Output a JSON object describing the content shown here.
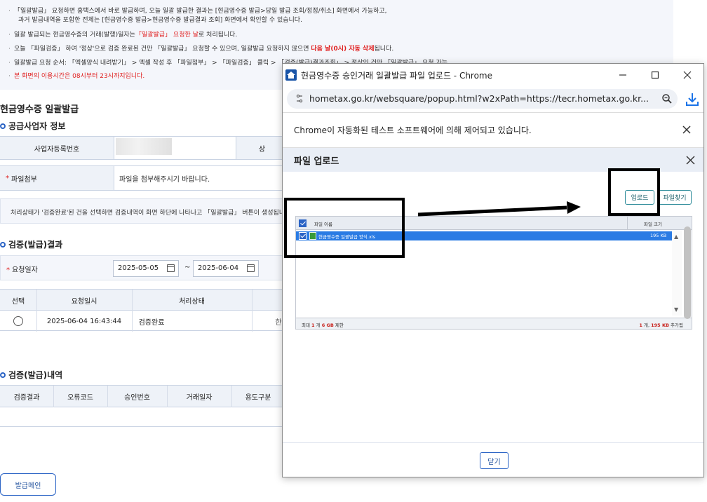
{
  "notice": {
    "line1": "「일괄발급」 요청하면 홈택스에서 바로 발급하며, 오늘 일괄 발급한 결과는 [현금영수증 발급>당일 발급 조회/정정/취소] 화면에서 가능하고,",
    "line2": "과거 발급내역을 포함한 전체는 [현금영수증 발급>현금영수증 발급결과 조회] 화면에서 확인할 수 있습니다.",
    "line3_pre": "일괄 발급되는 현금영수증의 거래(발행)일자는",
    "line3_red": "「일괄발급」 요청한 날",
    "line3_post": "로 처리됩니다.",
    "line4_pre": "오늘 「파일검증」 하여 '정상'으로 검증 완료된 건만 「일괄발급」 요청할 수 있으며, 일괄발급 요청하지 않으면",
    "line4_red": "다음 날(0시) 자동 삭제",
    "line4_post": "됩니다.",
    "line5": "일괄발급 요청 순서: 「엑셀양식 내려받기」 > 엑셀 작성 후 「파일첨부」 > 「파일검증」 클릭 > 「검증(발급)결과조회」 > 정상인 건만 「일괄발급」 요청 가능",
    "line6": "본 화면의 이용시간은 08시부터 23시까지입니다."
  },
  "page": {
    "title": "현금영수증 일괄발급",
    "sec_supplier": "공급사업자 정보",
    "biz_no_label": "사업자등록번호",
    "biz_label_cut": "상",
    "file_attach_label": "파일첨부",
    "file_attach_text": "파일을 첨부해주시기 바랍니다.",
    "status_note": "처리상태가 '검증완료'된 건을 선택하면 검증내역이 화면 하단에 나타나고 「일괄발급」 버튼이 생성됩니다.",
    "sec_result": "검증(발급)결과",
    "request_date_label": "요청일자",
    "date_from": "2025-05-05",
    "date_tilde": "~",
    "date_to": "2025-06-04",
    "result_headers": {
      "select": "선택",
      "request_time": "요청일시",
      "status": "처리상태"
    },
    "result_row": {
      "request_time": "2025-06-04 16:43:44",
      "status": "검증완료",
      "cut": "한"
    },
    "sec_detail": "검증(발급)내역",
    "detail_headers": {
      "verify": "검증결과",
      "error": "오류코드",
      "approval": "승인번호",
      "date": "거래일자",
      "purpose": "용도구분"
    },
    "main_button": "발급메인"
  },
  "popup": {
    "window_title": "현금영수증 승인거래 일괄발급 파일 업로드 - Chrome",
    "url": "hometax.go.kr/websquare/popup.html?w2xPath=https://tecr.hometax.go.kr...",
    "automation_msg": "Chrome이 자동화된 테스트 소프트웨어에 의해 제어되고 있습니다.",
    "dialog_title": "파일 업로드",
    "upload_button": "업로드",
    "find_button": "파일찾기",
    "col_name": "파일 이름",
    "col_size": "파일 크기",
    "file_name": "현금영수증 일괄발급 양식.xls",
    "file_size": "195 KB",
    "footer_left_pre": "최대",
    "footer_left_count": "1",
    "footer_left_mid": "개",
    "footer_left_size": "6 GB",
    "footer_left_post": "제한",
    "footer_right_count": "1",
    "footer_right_mid": "개,",
    "footer_right_size": "195 KB",
    "footer_right_post": "추가됨",
    "close_button": "닫기"
  },
  "colors": {
    "accent": "#2a63c5",
    "warning_red": "#e02020",
    "selected_row": "#2a7be4"
  }
}
